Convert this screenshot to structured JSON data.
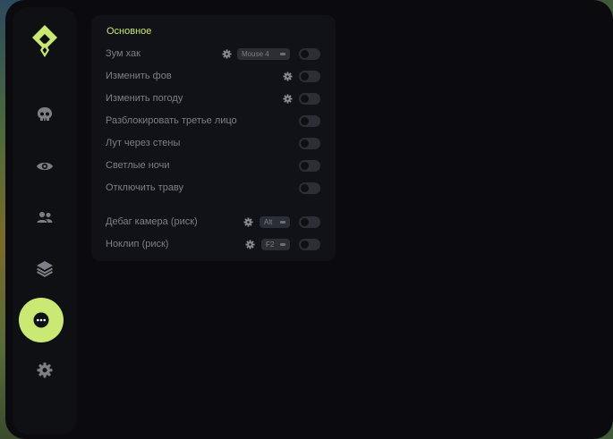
{
  "colors": {
    "accent": "#c9e874",
    "panel": "#111217",
    "window": "#0b0b0f",
    "sidebar": "#0f1014",
    "muted_text": "#7d7f87"
  },
  "sidebar": {
    "logo_icon": "diamond-logo-icon",
    "items": [
      {
        "icon": "skull-icon",
        "active": false
      },
      {
        "icon": "eye-icon",
        "active": false
      },
      {
        "icon": "users-icon",
        "active": false
      },
      {
        "icon": "layers-icon",
        "active": false
      },
      {
        "icon": "more-dots-icon",
        "active": true
      },
      {
        "icon": "gear-icon",
        "active": false
      }
    ]
  },
  "panel": {
    "title": "Основное",
    "rows": [
      {
        "label": "Зум хак",
        "settings": true,
        "keybind": "Mouse 4",
        "enabled": false
      },
      {
        "label": "Изменить фов",
        "settings": true,
        "enabled": false
      },
      {
        "label": "Изменить погоду",
        "settings": true,
        "enabled": false
      },
      {
        "label": "Разблокировать третье лицо",
        "enabled": false
      },
      {
        "label": "Лут через стены",
        "enabled": false
      },
      {
        "label": "Светлые ночи",
        "enabled": false
      },
      {
        "label": "Отключить траву",
        "enabled": false
      },
      {
        "label": "Дебаг камера (риск)",
        "settings": true,
        "keybind": "Alt",
        "enabled": false
      },
      {
        "label": "Ноклип (риск)",
        "settings": true,
        "keybind": "F2",
        "enabled": false
      }
    ]
  }
}
